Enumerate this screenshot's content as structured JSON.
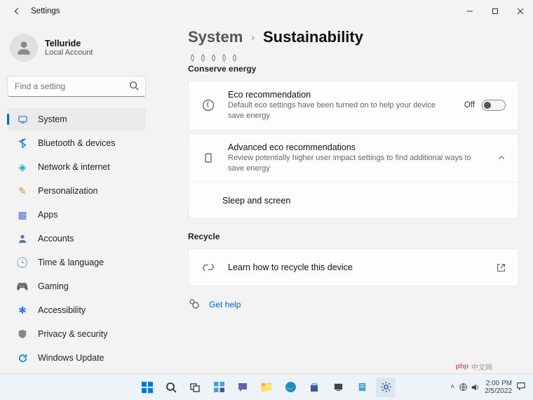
{
  "app_title": "Settings",
  "window_controls": {
    "min": "–",
    "max": "▢",
    "close": "✕"
  },
  "profile": {
    "name": "Telluride",
    "sub": "Local Account"
  },
  "search": {
    "placeholder": "Find a setting"
  },
  "nav": [
    {
      "id": "system",
      "label": "System",
      "icon": "🖥️",
      "selected": true
    },
    {
      "id": "bluetooth",
      "label": "Bluetooth & devices",
      "icon": "bt"
    },
    {
      "id": "network",
      "label": "Network & internet",
      "icon": "📶"
    },
    {
      "id": "personalization",
      "label": "Personalization",
      "icon": "🖌️"
    },
    {
      "id": "apps",
      "label": "Apps",
      "icon": "▦"
    },
    {
      "id": "accounts",
      "label": "Accounts",
      "icon": "👤"
    },
    {
      "id": "time",
      "label": "Time & language",
      "icon": "🌐"
    },
    {
      "id": "gaming",
      "label": "Gaming",
      "icon": "🎮"
    },
    {
      "id": "accessibility",
      "label": "Accessibility",
      "icon": "✶"
    },
    {
      "id": "privacy",
      "label": "Privacy & security",
      "icon": "🛡️"
    },
    {
      "id": "update",
      "label": "Windows Update",
      "icon": "🔄"
    }
  ],
  "breadcrumb": {
    "parent": "System",
    "current": "Sustainability"
  },
  "sections": {
    "conserve": {
      "title": "Conserve energy",
      "items": [
        {
          "title": "Eco recommendation",
          "sub": "Default eco settings have been turned on to help your device save energy",
          "toggle_label": "Off"
        },
        {
          "title": "Advanced eco recommendations",
          "sub": "Review potentially higher user impact settings to find additional ways to save energy"
        },
        {
          "title": "Sleep and screen"
        }
      ]
    },
    "recycle": {
      "title": "Recycle",
      "items": [
        {
          "title": "Learn how to recycle this device"
        }
      ]
    }
  },
  "help": {
    "label": "Get help"
  },
  "taskbar": {
    "tray": {
      "time": "2:00 PM",
      "date": "2/5/2022"
    }
  },
  "watermark": "中文网"
}
